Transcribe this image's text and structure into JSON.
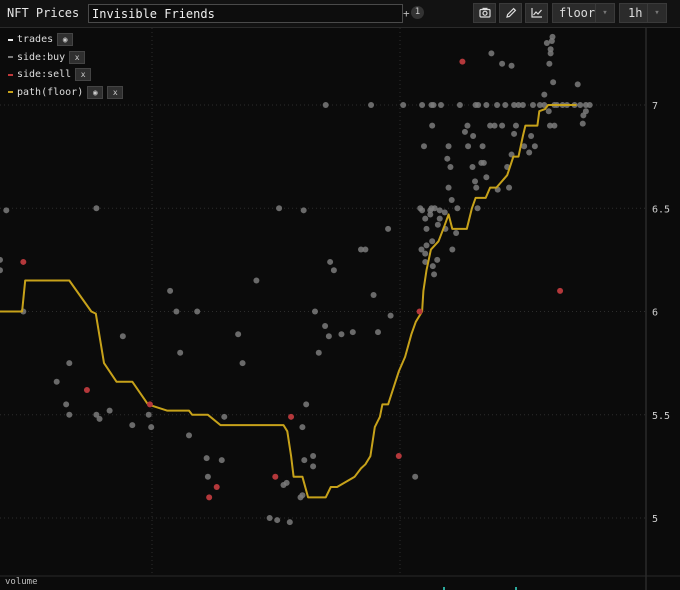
{
  "app": {
    "title": "NFT Prices"
  },
  "search": {
    "value": "Invisible Friends",
    "plus": "+",
    "count": "1"
  },
  "toolbar": {
    "camera": "camera-icon",
    "pencil": "pencil-icon",
    "chart": "chart-icon",
    "series_select": "floor",
    "interval_select": "1h",
    "caret": "▾"
  },
  "legend": [
    {
      "label": "trades",
      "color": "#e8e8e8",
      "buttons": [
        "◉"
      ]
    },
    {
      "label": "side:buy",
      "color": "#7a7a7a",
      "buttons": [
        "x"
      ]
    },
    {
      "label": "side:sell",
      "color": "#c0393b",
      "buttons": [
        "x"
      ]
    },
    {
      "label": "path(floor)",
      "color": "#c7a21a",
      "buttons": [
        "◉",
        "x"
      ]
    }
  ],
  "volume_label": "volume",
  "colors": {
    "buy": "#7b7b7b",
    "sell": "#b4383b",
    "floor": "#c7a21a",
    "grid": "#2c2c2c"
  },
  "chart_data": {
    "type": "scatter",
    "y_ticks": [
      5,
      5.5,
      6,
      6.5,
      7
    ],
    "ylim": [
      4.7,
      7.35
    ],
    "xlim": [
      0,
      100
    ],
    "grid": true,
    "legend_placement": "top-left",
    "series": [
      {
        "name": "side:buy",
        "points": [
          [
            1,
            6.49
          ],
          [
            0,
            6.25
          ],
          [
            0,
            6.2
          ],
          [
            3.7,
            6.0
          ],
          [
            9,
            5.66
          ],
          [
            10.5,
            5.55
          ],
          [
            11,
            5.75
          ],
          [
            11,
            5.5
          ],
          [
            15.3,
            6.5
          ],
          [
            15.3,
            5.5
          ],
          [
            15.8,
            5.48
          ],
          [
            17.4,
            5.52
          ],
          [
            19.5,
            5.88
          ],
          [
            21,
            5.45
          ],
          [
            23.6,
            5.5
          ],
          [
            24,
            5.44
          ],
          [
            27,
            6.1
          ],
          [
            28,
            6.0
          ],
          [
            28.6,
            5.8
          ],
          [
            30,
            5.4
          ],
          [
            31.3,
            6.0
          ],
          [
            32.8,
            5.29
          ],
          [
            33,
            5.2
          ],
          [
            35.2,
            5.28
          ],
          [
            35.6,
            5.49
          ],
          [
            37.8,
            5.89
          ],
          [
            38.5,
            5.75
          ],
          [
            40.7,
            6.15
          ],
          [
            42.8,
            5.0
          ],
          [
            44,
            4.99
          ],
          [
            44.3,
            6.5
          ],
          [
            45,
            5.16
          ],
          [
            45.5,
            5.17
          ],
          [
            46,
            4.98
          ],
          [
            47.7,
            5.1
          ],
          [
            48,
            5.11
          ],
          [
            48,
            5.44
          ],
          [
            48.2,
            6.49
          ],
          [
            48.3,
            5.28
          ],
          [
            48.6,
            5.55
          ],
          [
            49.7,
            5.3
          ],
          [
            49.7,
            5.25
          ],
          [
            50,
            6.0
          ],
          [
            50.6,
            5.8
          ],
          [
            51.6,
            5.93
          ],
          [
            51.7,
            7.0
          ],
          [
            52.2,
            5.88
          ],
          [
            52.4,
            6.24
          ],
          [
            53,
            6.2
          ],
          [
            54.2,
            5.89
          ],
          [
            56,
            5.9
          ],
          [
            57.3,
            6.3
          ],
          [
            58,
            6.3
          ],
          [
            58.9,
            7.0
          ],
          [
            59.3,
            6.08
          ],
          [
            60,
            5.9
          ],
          [
            61.6,
            6.4
          ],
          [
            62,
            5.98
          ],
          [
            64,
            7.0
          ],
          [
            65.9,
            5.2
          ],
          [
            66.7,
            6.5
          ],
          [
            66.9,
            6.3
          ],
          [
            67,
            6.49
          ],
          [
            67,
            7.0
          ],
          [
            67.3,
            6.8
          ],
          [
            67.5,
            6.24
          ],
          [
            67.5,
            6.45
          ],
          [
            67.5,
            6.28
          ],
          [
            67.7,
            6.4
          ],
          [
            67.7,
            6.32
          ],
          [
            68.3,
            6.49
          ],
          [
            68.3,
            6.47
          ],
          [
            68.5,
            6.5
          ],
          [
            68.5,
            7.0
          ],
          [
            68.6,
            6.9
          ],
          [
            68.6,
            6.34
          ],
          [
            68.7,
            6.22
          ],
          [
            68.8,
            7.0
          ],
          [
            68.9,
            6.18
          ],
          [
            69,
            6.5
          ],
          [
            69.4,
            6.25
          ],
          [
            69.5,
            6.42
          ],
          [
            69.8,
            6.45
          ],
          [
            69.8,
            6.49
          ],
          [
            70,
            7.0
          ],
          [
            70.6,
            6.48
          ],
          [
            70.7,
            6.4
          ],
          [
            71,
            6.74
          ],
          [
            71.2,
            6.6
          ],
          [
            71.2,
            6.8
          ],
          [
            71.5,
            6.7
          ],
          [
            71.7,
            6.54
          ],
          [
            71.8,
            6.3
          ],
          [
            72.4,
            6.38
          ],
          [
            72.6,
            6.5
          ],
          [
            73,
            7.0
          ],
          [
            73.8,
            6.87
          ],
          [
            74.2,
            6.9
          ],
          [
            74.3,
            6.8
          ],
          [
            75,
            6.7
          ],
          [
            75.1,
            6.85
          ],
          [
            75.4,
            6.63
          ],
          [
            75.5,
            7.0
          ],
          [
            75.6,
            6.6
          ],
          [
            75.8,
            6.5
          ],
          [
            75.9,
            7.0
          ],
          [
            76.4,
            6.72
          ],
          [
            76.6,
            6.8
          ],
          [
            76.8,
            6.72
          ],
          [
            77.2,
            6.65
          ],
          [
            77.2,
            7.0
          ],
          [
            77.8,
            6.9
          ],
          [
            78,
            7.25
          ],
          [
            78.5,
            6.9
          ],
          [
            78.9,
            7.0
          ],
          [
            79,
            6.59
          ],
          [
            79.7,
            6.9
          ],
          [
            79.7,
            7.2
          ],
          [
            80.2,
            7.0
          ],
          [
            80.5,
            6.7
          ],
          [
            80.8,
            6.6
          ],
          [
            81.2,
            7.19
          ],
          [
            81.2,
            6.76
          ],
          [
            81.6,
            6.86
          ],
          [
            81.6,
            7.0
          ],
          [
            81.9,
            6.9
          ],
          [
            82.3,
            7.0
          ],
          [
            83,
            7.0
          ],
          [
            83.2,
            6.8
          ],
          [
            84,
            6.77
          ],
          [
            84.3,
            6.85
          ],
          [
            84.6,
            7.0
          ],
          [
            84.9,
            6.8
          ],
          [
            85.7,
            7.0
          ],
          [
            86.4,
            7.0
          ],
          [
            86.4,
            7.05
          ],
          [
            86.8,
            7.3
          ],
          [
            87.1,
            6.97
          ],
          [
            87.2,
            7.2
          ],
          [
            87.3,
            6.9
          ],
          [
            87.4,
            7.25
          ],
          [
            87.4,
            7.27
          ],
          [
            87.6,
            7.31
          ],
          [
            87.7,
            7.33
          ],
          [
            87.8,
            7.11
          ],
          [
            88,
            7.0
          ],
          [
            88,
            6.9
          ],
          [
            88.4,
            7.0
          ],
          [
            89.3,
            7.0
          ],
          [
            90,
            7.0
          ],
          [
            91.2,
            7.0
          ],
          [
            91.7,
            7.1
          ],
          [
            91.8,
            7.44
          ],
          [
            92.1,
            7.0
          ],
          [
            92.5,
            6.91
          ],
          [
            92.6,
            6.95
          ],
          [
            93,
            7.0
          ],
          [
            93,
            6.97
          ],
          [
            93.6,
            7.0
          ]
        ]
      },
      {
        "name": "side:sell",
        "points": [
          [
            3.7,
            6.24
          ],
          [
            13.8,
            5.62
          ],
          [
            23.8,
            5.55
          ],
          [
            33.2,
            5.1
          ],
          [
            34.4,
            5.15
          ],
          [
            43.7,
            5.2
          ],
          [
            46.2,
            5.49
          ],
          [
            63.3,
            5.3
          ],
          [
            66.6,
            6.0
          ],
          [
            73.4,
            7.21
          ],
          [
            88.9,
            6.1
          ]
        ]
      },
      {
        "name": "path(floor)",
        "points": [
          [
            0,
            6.0
          ],
          [
            3.5,
            6.0
          ],
          [
            4,
            6.15
          ],
          [
            11,
            6.15
          ],
          [
            14.5,
            6.0
          ],
          [
            15.2,
            5.99
          ],
          [
            16.5,
            5.75
          ],
          [
            18.5,
            5.66
          ],
          [
            21,
            5.66
          ],
          [
            23.5,
            5.55
          ],
          [
            26.5,
            5.52
          ],
          [
            30,
            5.52
          ],
          [
            30.5,
            5.5
          ],
          [
            33,
            5.5
          ],
          [
            35,
            5.45
          ],
          [
            45,
            5.45
          ],
          [
            45.6,
            5.42
          ],
          [
            46.2,
            5.3
          ],
          [
            46.6,
            5.2
          ],
          [
            48,
            5.2
          ],
          [
            48.9,
            5.1
          ],
          [
            51.7,
            5.1
          ],
          [
            52.5,
            5.15
          ],
          [
            53.5,
            5.15
          ],
          [
            56.3,
            5.2
          ],
          [
            57.3,
            5.24
          ],
          [
            58,
            5.26
          ],
          [
            58.8,
            5.3
          ],
          [
            59.5,
            5.44
          ],
          [
            60.3,
            5.49
          ],
          [
            60.7,
            5.55
          ],
          [
            61.6,
            5.55
          ],
          [
            63.3,
            5.71
          ],
          [
            64.3,
            5.78
          ],
          [
            65.3,
            5.89
          ],
          [
            66,
            5.95
          ],
          [
            67,
            6.0
          ],
          [
            67.2,
            6.1
          ],
          [
            67.7,
            6.2
          ],
          [
            68.4,
            6.3
          ],
          [
            69.6,
            6.34
          ],
          [
            70.5,
            6.41
          ],
          [
            71.2,
            6.47
          ],
          [
            71.8,
            6.4
          ],
          [
            74.1,
            6.4
          ],
          [
            74.9,
            6.5
          ],
          [
            75.5,
            6.55
          ],
          [
            77.1,
            6.55
          ],
          [
            77.8,
            6.6
          ],
          [
            78.8,
            6.6
          ],
          [
            80.5,
            6.66
          ],
          [
            81.5,
            6.75
          ],
          [
            82.3,
            6.75
          ],
          [
            83,
            6.85
          ],
          [
            83.4,
            6.9
          ],
          [
            85.3,
            6.9
          ],
          [
            85.6,
            6.97
          ],
          [
            86.5,
            6.98
          ],
          [
            87,
            7.0
          ],
          [
            91.5,
            7.0
          ]
        ]
      }
    ]
  }
}
